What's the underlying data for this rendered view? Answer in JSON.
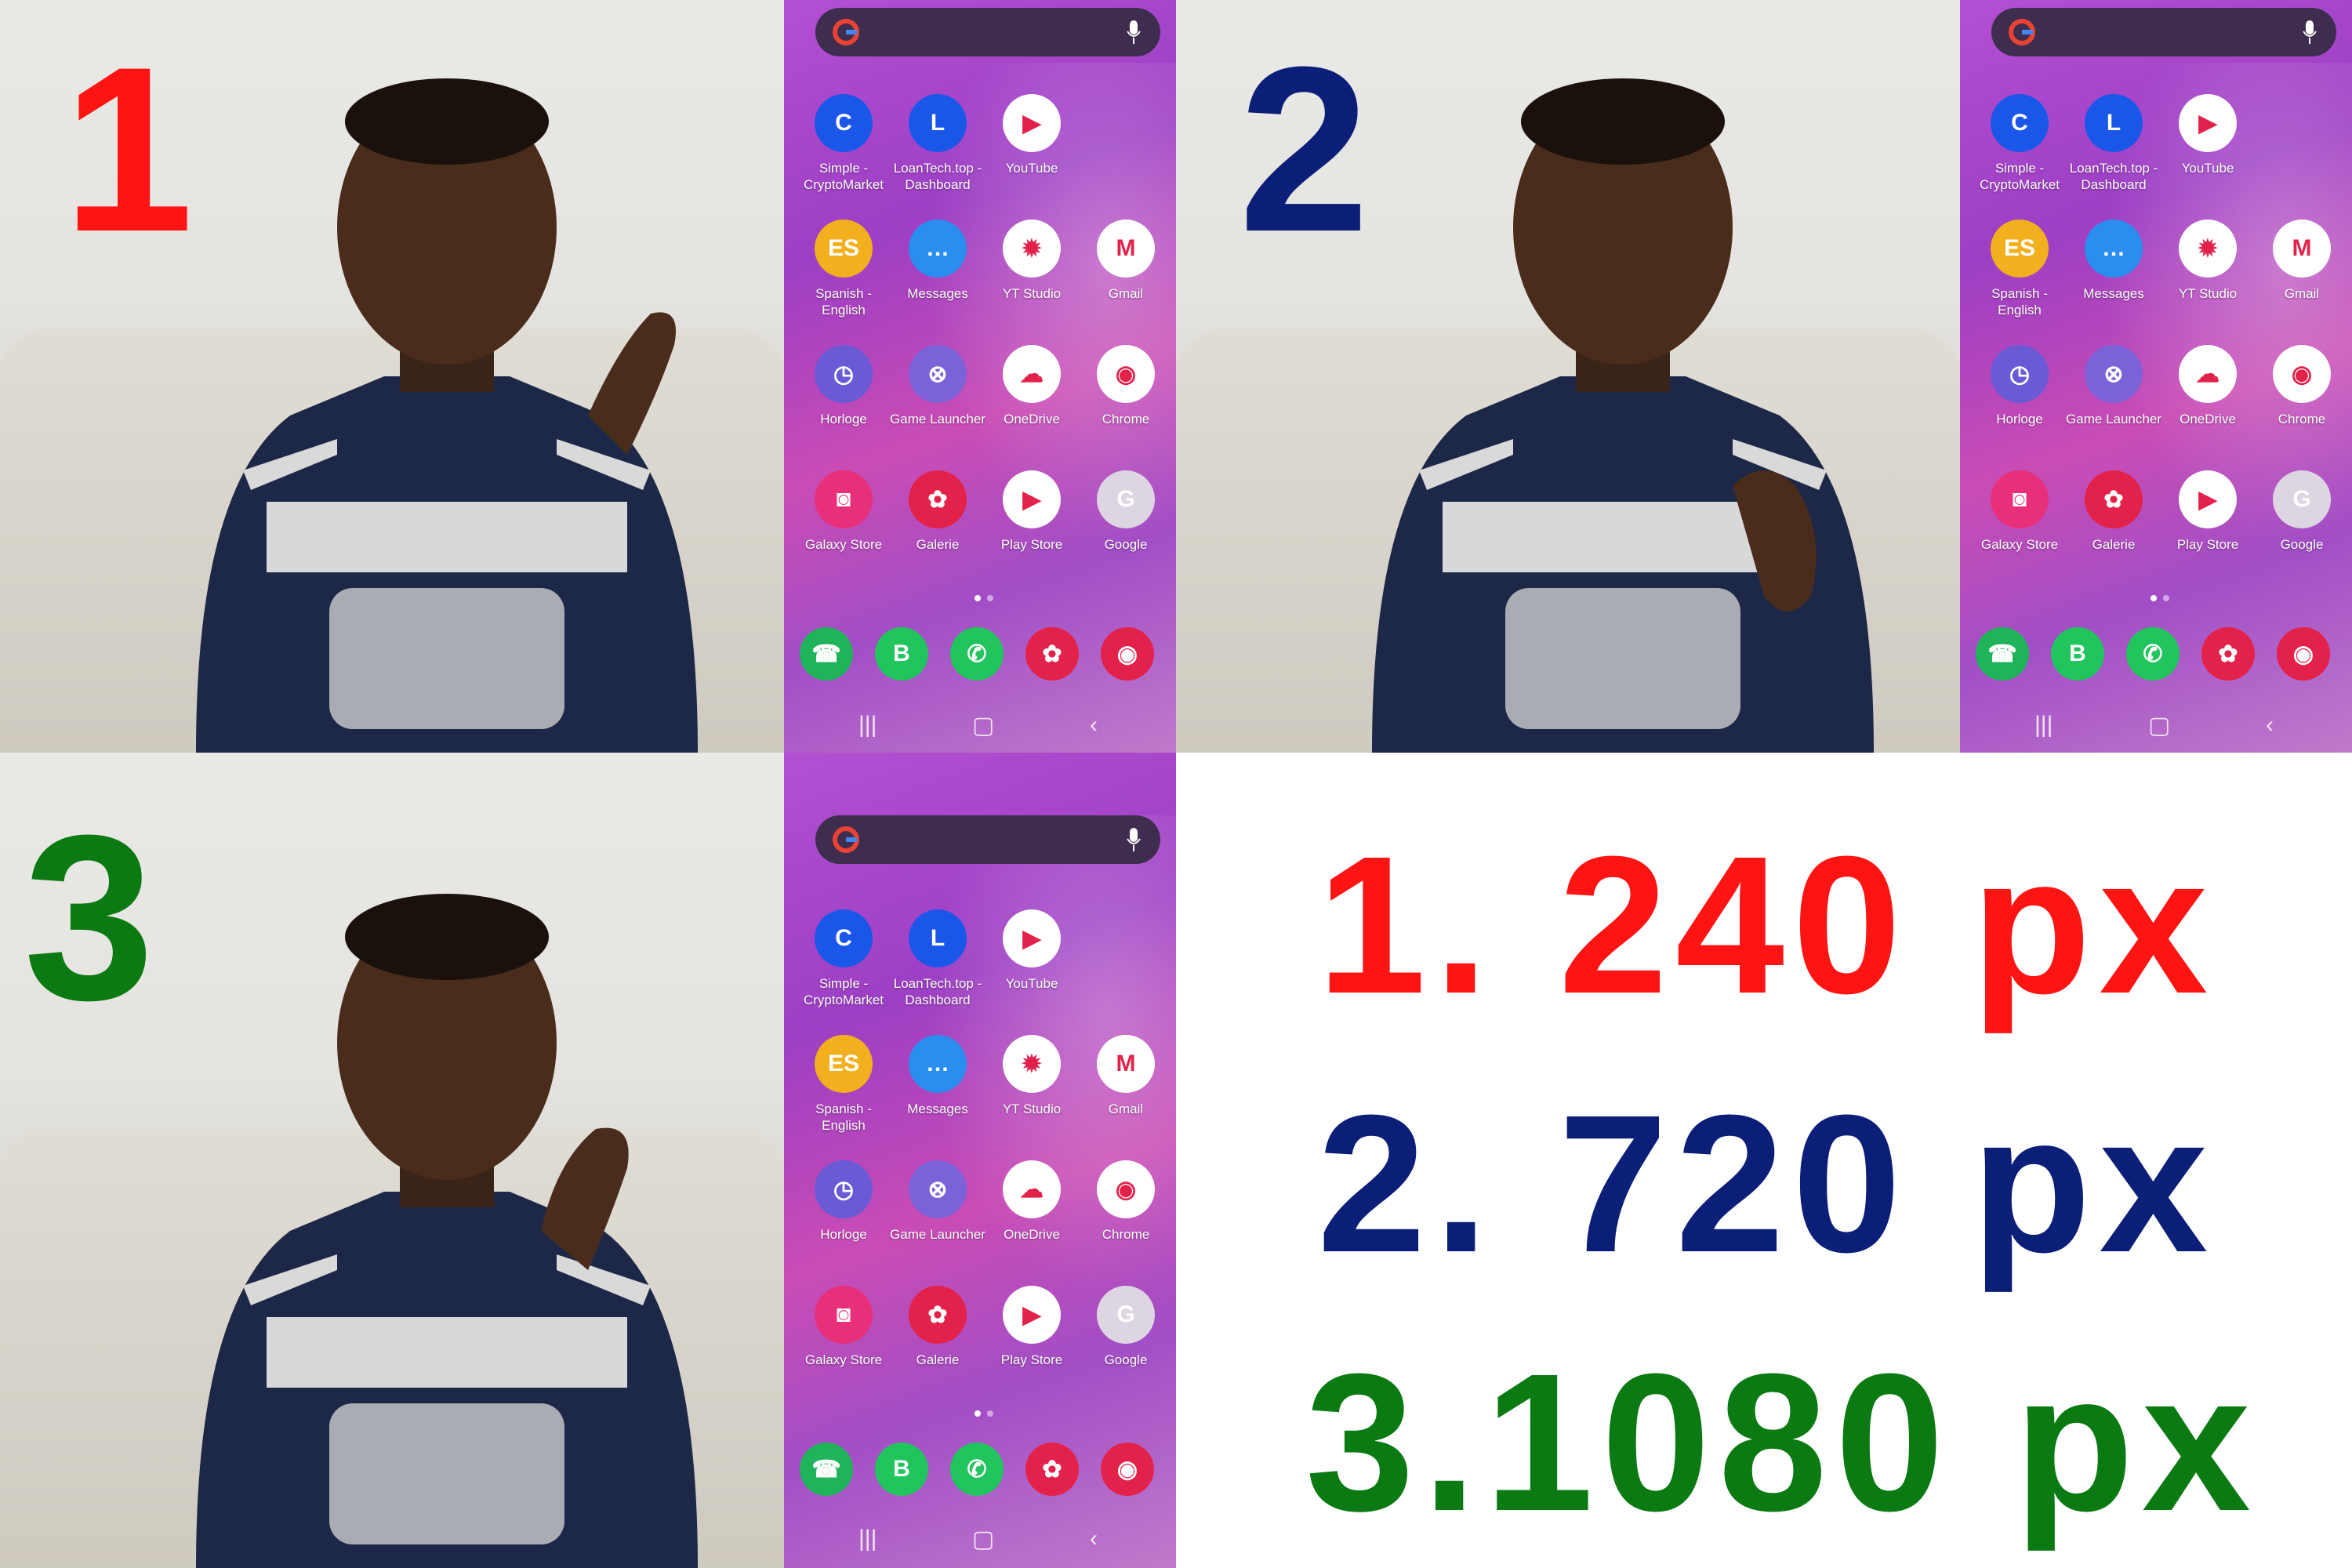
{
  "panels": [
    {
      "number": "1",
      "color": "#ff1414"
    },
    {
      "number": "2",
      "color": "#0c1f78"
    },
    {
      "number": "3",
      "color": "#0b7a12"
    }
  ],
  "phone": {
    "apps": [
      {
        "label": "Simple - CryptoMarket",
        "icon": "cryptomarket-icon",
        "color": "#1a57e8",
        "glyph": "C"
      },
      {
        "label": "LoanTech.top - Dashboard",
        "icon": "loantech-icon",
        "color": "#1a57e8",
        "glyph": "L"
      },
      {
        "label": "YouTube",
        "icon": "youtube-icon",
        "color": "#ffffff",
        "glyph": "▶"
      },
      {
        "label": "Spanish - English",
        "icon": "spanish-english-icon",
        "color": "#f2b01e",
        "glyph": "ES"
      },
      {
        "label": "Messages",
        "icon": "messages-icon",
        "color": "#2a8df0",
        "glyph": "…"
      },
      {
        "label": "YT Studio",
        "icon": "yt-studio-icon",
        "color": "#ffffff",
        "glyph": "✹"
      },
      {
        "label": "Gmail",
        "icon": "gmail-icon",
        "color": "#ffffff",
        "glyph": "M"
      },
      {
        "label": "Horloge",
        "icon": "clock-icon",
        "color": "#6a5ad6",
        "glyph": "◷"
      },
      {
        "label": "Game Launcher",
        "icon": "game-launcher-icon",
        "color": "#7b62d8",
        "glyph": "⊗"
      },
      {
        "label": "OneDrive",
        "icon": "onedrive-icon",
        "color": "#ffffff",
        "glyph": "☁"
      },
      {
        "label": "Chrome",
        "icon": "chrome-icon",
        "color": "#ffffff",
        "glyph": "◉"
      },
      {
        "label": "Galaxy Store",
        "icon": "galaxy-store-icon",
        "color": "#e8307a",
        "glyph": "◙"
      },
      {
        "label": "Galerie",
        "icon": "gallery-icon",
        "color": "#e2224a",
        "glyph": "✿"
      },
      {
        "label": "Play Store",
        "icon": "play-store-icon",
        "color": "#ffffff",
        "glyph": "▶"
      },
      {
        "label": "Google",
        "icon": "google-folder-icon",
        "color": "#ddd6e2",
        "glyph": "G"
      }
    ],
    "dock": [
      {
        "icon": "phone-icon",
        "color": "#1fb35a",
        "glyph": "☎"
      },
      {
        "icon": "whatsapp-business-icon",
        "color": "#22c45e",
        "glyph": "B"
      },
      {
        "icon": "whatsapp-icon",
        "color": "#22c45e",
        "glyph": "✆"
      },
      {
        "icon": "galaxy-flower-icon",
        "color": "#e2224a",
        "glyph": "✿"
      },
      {
        "icon": "camera-icon",
        "color": "#e2224a",
        "glyph": "◉"
      }
    ]
  },
  "results": [
    {
      "text": "1. 240 px",
      "color": "#ff1414"
    },
    {
      "text": "2. 720 px",
      "color": "#0c1f78"
    },
    {
      "text": "3.1080 px",
      "color": "#0b7a12"
    }
  ]
}
